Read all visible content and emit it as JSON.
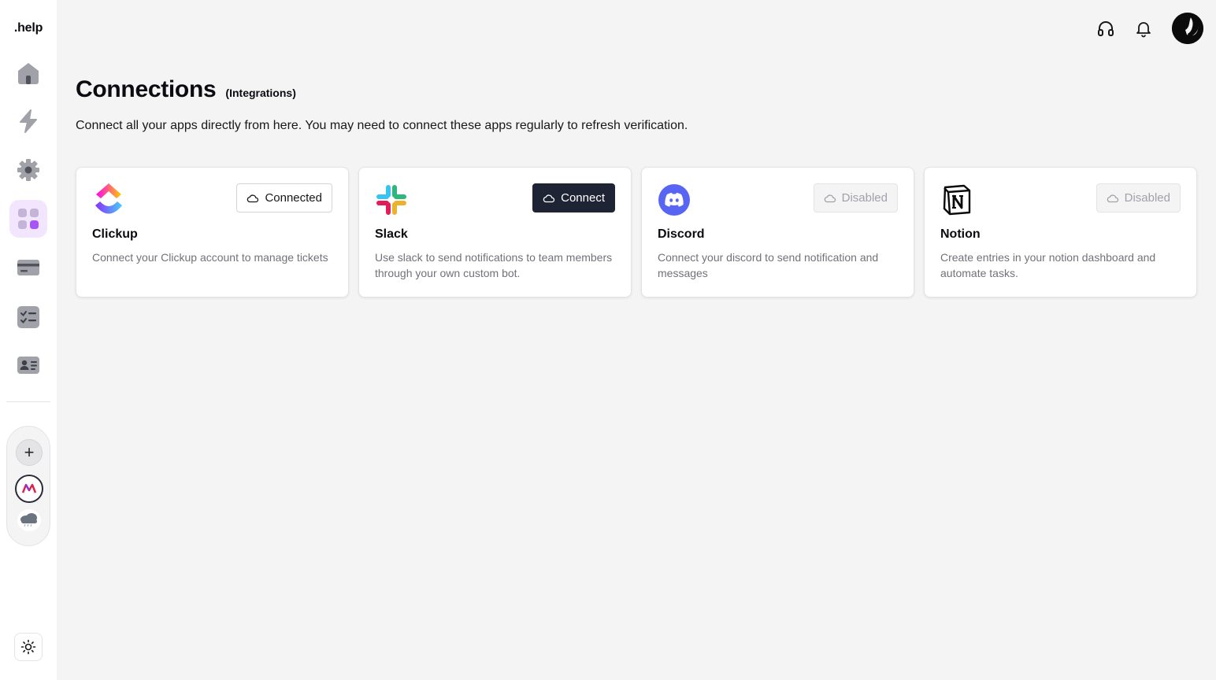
{
  "app": {
    "logo": ".help"
  },
  "sidebar": {
    "nav": [
      {
        "name": "home",
        "icon": "home-icon"
      },
      {
        "name": "automations",
        "icon": "lightning-icon"
      },
      {
        "name": "settings",
        "icon": "gear-icon"
      },
      {
        "name": "integrations",
        "icon": "grid-icon",
        "active": true
      },
      {
        "name": "billing",
        "icon": "credit-card-icon"
      },
      {
        "name": "tasks",
        "icon": "checklist-icon"
      },
      {
        "name": "contacts",
        "icon": "contact-card-icon"
      }
    ],
    "workspaces": {
      "add_label": "+",
      "items": [
        {
          "icon": "m-logo-icon"
        },
        {
          "icon": "cloud-logo-icon"
        }
      ]
    },
    "theme_icon": "sun-icon"
  },
  "topbar": {
    "icons": [
      "headphones-icon",
      "bell-icon",
      "avatar"
    ]
  },
  "header": {
    "title": "Connections",
    "subtitle": "(Integrations)",
    "description": "Connect all your apps directly from here. You may need to connect these apps regularly to refresh verification."
  },
  "connections": [
    {
      "name": "Clickup",
      "description": "Connect your Clickup account to manage tickets",
      "button": "Connected",
      "state": "connected",
      "icon": "clickup-logo-icon"
    },
    {
      "name": "Slack",
      "description": "Use slack to send notifications to team members through your own custom bot.",
      "button": "Connect",
      "state": "available",
      "icon": "slack-logo-icon"
    },
    {
      "name": "Discord",
      "description": "Connect your discord to send notification and messages",
      "button": "Disabled",
      "state": "disabled",
      "icon": "discord-logo-icon"
    },
    {
      "name": "Notion",
      "description": "Create entries in your notion dashboard and automate tasks.",
      "button": "Disabled",
      "state": "disabled",
      "icon": "notion-logo-icon"
    }
  ],
  "colors": {
    "accent_active_bg": "#f1e6fd",
    "accent_purple": "#a855f7",
    "dark_button": "#1e2433",
    "discord": "#5865f2"
  }
}
